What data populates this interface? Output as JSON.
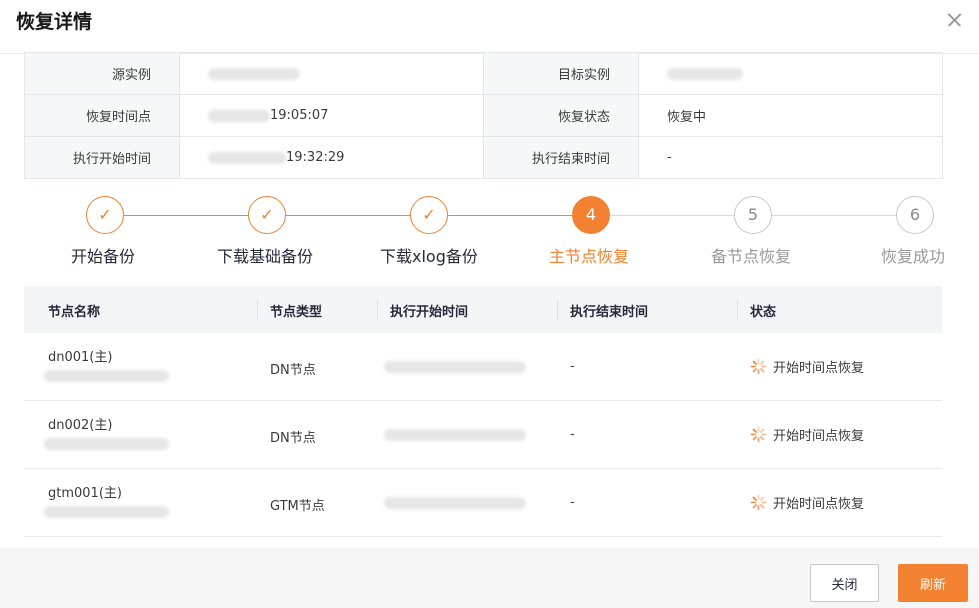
{
  "dialog": {
    "title": "恢复详情"
  },
  "info": {
    "source_label": "源实例",
    "source_value": "",
    "target_label": "目标实例",
    "target_value": "",
    "restore_time_label": "恢复时间点",
    "restore_time_value": "19:05:07",
    "restore_status_label": "恢复状态",
    "restore_status_value": "恢复中",
    "exec_start_label": "执行开始时间",
    "exec_start_value": "19:32:29",
    "exec_end_label": "执行结束时间",
    "exec_end_value": "-"
  },
  "steps": [
    {
      "index": "✓",
      "label": "开始备份",
      "state": "done"
    },
    {
      "index": "✓",
      "label": "下载基础备份",
      "state": "done"
    },
    {
      "index": "✓",
      "label": "下载xlog备份",
      "state": "done"
    },
    {
      "index": "4",
      "label": "主节点恢复",
      "state": "active"
    },
    {
      "index": "5",
      "label": "备节点恢复",
      "state": "pending"
    },
    {
      "index": "6",
      "label": "恢复成功",
      "state": "pending"
    }
  ],
  "table": {
    "headers": [
      "节点名称",
      "节点类型",
      "执行开始时间",
      "执行结束时间",
      "状态"
    ],
    "rows": [
      {
        "name": "dn001(主)",
        "sub": "",
        "type": "DN节点",
        "start": "",
        "end": "-",
        "status": "开始时间点恢复"
      },
      {
        "name": "dn002(主)",
        "sub": "",
        "type": "DN节点",
        "start": "",
        "end": "-",
        "status": "开始时间点恢复"
      },
      {
        "name": "gtm001(主)",
        "sub": "",
        "type": "GTM节点",
        "start": "",
        "end": "-",
        "status": "开始时间点恢复"
      }
    ]
  },
  "footer": {
    "close_label": "关闭",
    "refresh_label": "刷新"
  },
  "colors": {
    "accent": "#f28131",
    "pending": "#c9c9c9"
  },
  "icons": {
    "close": "close-icon",
    "check": "check-icon",
    "status": "loading-spinner-icon"
  }
}
